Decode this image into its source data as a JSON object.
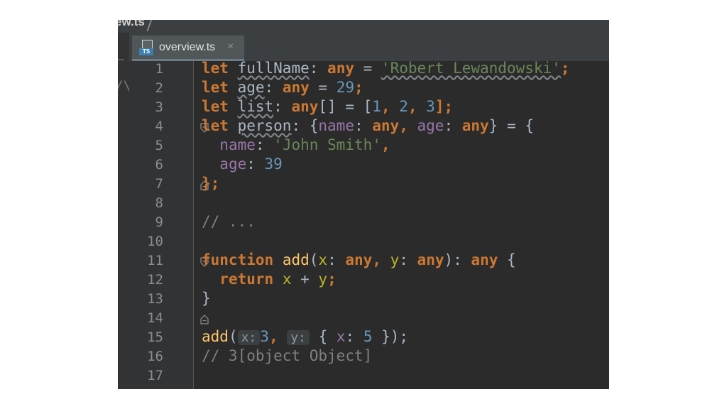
{
  "breadcrumb": "ew.ts",
  "tab": {
    "label": "overview.ts",
    "badge": "TS",
    "close": "×"
  },
  "left_stub": "/\\",
  "line_numbers": [
    "1",
    "2",
    "3",
    "4",
    "5",
    "6",
    "7",
    "8",
    "9",
    "10",
    "11",
    "12",
    "13",
    "14",
    "15",
    "16",
    "17"
  ],
  "code": {
    "l1": {
      "kw": "let",
      "name": "fullName",
      "colon": ": ",
      "type": "any",
      "eq": " = ",
      "str": "'Robert Lewandowski'",
      "end": ";"
    },
    "l2": {
      "kw": "let",
      "name": "age",
      "colon": ": ",
      "type": "any",
      "eq": " = ",
      "num": "29",
      "end": ";"
    },
    "l3": {
      "kw": "let",
      "name": "list",
      "colon": ": ",
      "type": "any",
      "br": "[] = [",
      "n1": "1",
      "c1": ", ",
      "n2": "2",
      "c2": ", ",
      "n3": "3",
      "end": "];"
    },
    "l4": {
      "kw": "let",
      "name": "person",
      "colon": ": {",
      "p1": "name",
      "c1": ": ",
      "t1": "any",
      "comma": ", ",
      "p2": "age",
      "c2": ": ",
      "t2": "any",
      "end": "} = {"
    },
    "l5": {
      "prop": "name",
      "colon": ": ",
      "str": "'John Smith'",
      "end": ","
    },
    "l6": {
      "prop": "age",
      "colon": ": ",
      "num": "39"
    },
    "l7": {
      "end": "};"
    },
    "l9": {
      "comment": "// ..."
    },
    "l11": {
      "kw": "function",
      "fn": "add",
      "open": "(",
      "x": "x",
      "c1": ": ",
      "t1": "any",
      "comma": ", ",
      "y": "y",
      "c2": ": ",
      "t2": "any",
      "close": "): ",
      "rt": "any",
      "brace": " {"
    },
    "l12": {
      "kw": "return",
      "x": "x",
      "plus": " + ",
      "y": "y",
      "end": ";"
    },
    "l13": {
      "end": "}"
    },
    "l15": {
      "fn": "add",
      "open": "(",
      "hint_x": "x:",
      "num": "3",
      "comma": ", ",
      "hint_y": "y:",
      "obj_open": "{ ",
      "x": "x",
      "colon": ": ",
      "num2": "5",
      "obj_close": " });"
    },
    "l16": {
      "comment": "// 3[object Object]"
    }
  },
  "colors": {
    "keyword": "#cc7832",
    "string": "#6a8759",
    "number": "#6897bb",
    "function": "#ffc66d",
    "property": "#9876aa",
    "comment": "#808080",
    "background": "#2b2b2b"
  }
}
